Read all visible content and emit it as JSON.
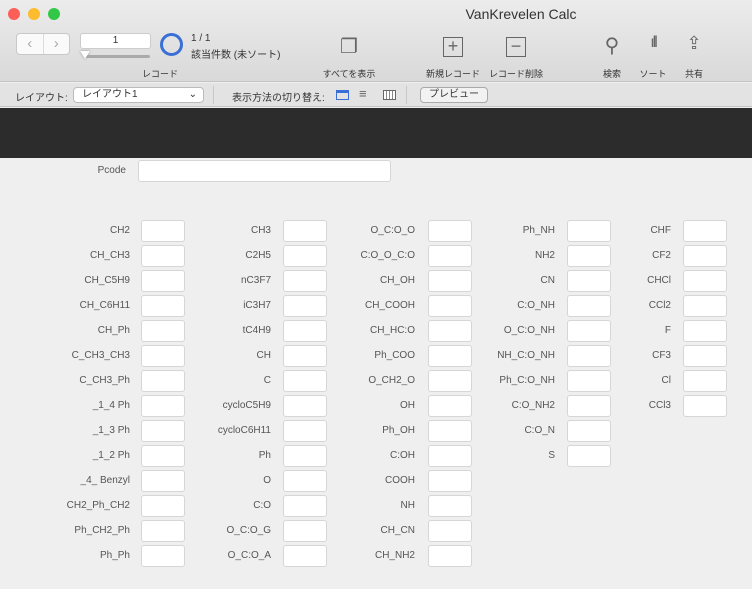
{
  "window": {
    "title": "VanKrevelen Calc",
    "traffic_lights": [
      "#fc5f57",
      "#fdbc2e",
      "#33c748"
    ]
  },
  "toolbar": {
    "record_number": "1",
    "found": "1 / 1",
    "found_detail": "該当件数 (未ソート)",
    "record_label": "レコード",
    "show_all": "すべてを表示",
    "new_record": "新規レコード",
    "delete_record": "レコード削除",
    "find": "検索",
    "sort": "ソート",
    "share": "共有",
    "accent": "#3a6fd8"
  },
  "layoutbar": {
    "layout_label": "レイアウト:",
    "layout_value": "レイアウト1",
    "view_as_label": "表示方法の切り替え:",
    "preview": "プレビュー"
  },
  "form": {
    "pcode_label": "Pcode",
    "pcode_value": "",
    "columns": [
      [
        "CH2",
        "CH_CH3",
        "CH_C5H9",
        "CH_C6H11",
        "CH_Ph",
        "C_CH3_CH3",
        "C_CH3_Ph",
        "_1_4 Ph",
        "_1_3 Ph",
        "_1_2 Ph",
        "_4_ Benzyl",
        "CH2_Ph_CH2",
        "Ph_CH2_Ph",
        "Ph_Ph"
      ],
      [
        "CH3",
        "C2H5",
        "nC3F7",
        "iC3H7",
        "tC4H9",
        "CH",
        "C",
        "cycloC5H9",
        "cycloC6H11",
        "Ph",
        "O",
        "C:O",
        "O_C:O_G",
        "O_C:O_A"
      ],
      [
        "O_C:O_O",
        "C:O_O_C:O",
        "CH_OH",
        "CH_COOH",
        "CH_HC:O",
        "Ph_COO",
        "O_CH2_O",
        "OH",
        "Ph_OH",
        "C:OH",
        "COOH",
        "NH",
        "CH_CN",
        "CH_NH2"
      ],
      [
        "Ph_NH",
        "NH2",
        "CN",
        "C:O_NH",
        "O_C:O_NH",
        "NH_C:O_NH",
        "Ph_C:O_NH",
        "C:O_NH2",
        "C:O_N",
        "S"
      ],
      [
        "CHF",
        "CF2",
        "CHCl",
        "CCl2",
        "F",
        "CF3",
        "Cl",
        "CCl3"
      ]
    ]
  }
}
